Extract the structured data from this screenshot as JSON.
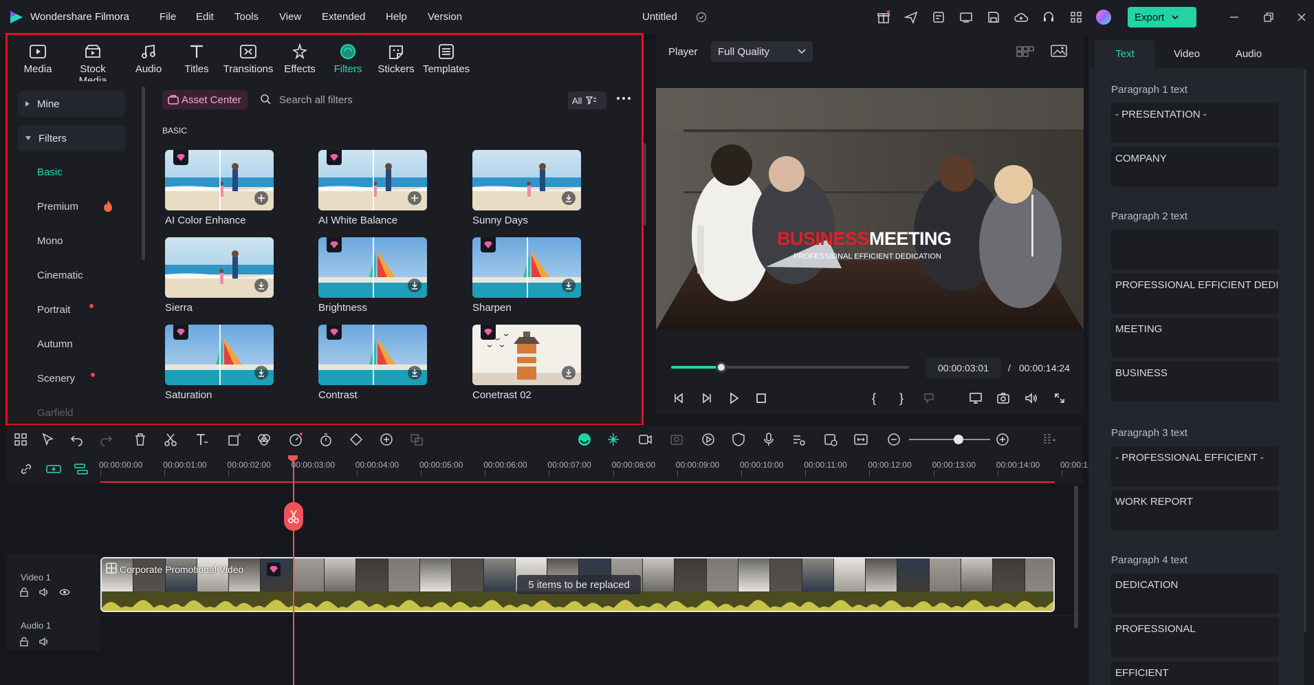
{
  "app": {
    "name": "Wondershare Filmora",
    "project_title": "Untitled",
    "menu": [
      "File",
      "Edit",
      "Tools",
      "View",
      "Extended",
      "Help",
      "Version"
    ],
    "export_label": "Export"
  },
  "media_tabs": [
    {
      "label": "Media",
      "icon": "media-icon"
    },
    {
      "label": "Stock Media",
      "icon": "stock-media-icon"
    },
    {
      "label": "Audio",
      "icon": "audio-icon"
    },
    {
      "label": "Titles",
      "icon": "titles-icon"
    },
    {
      "label": "Transitions",
      "icon": "transitions-icon"
    },
    {
      "label": "Effects",
      "icon": "effects-icon"
    },
    {
      "label": "Filters",
      "icon": "filters-icon",
      "active": true
    },
    {
      "label": "Stickers",
      "icon": "stickers-icon"
    },
    {
      "label": "Templates",
      "icon": "templates-icon"
    }
  ],
  "side_nav": {
    "mine": "Mine",
    "filters": "Filters",
    "items": [
      "Basic",
      "Premium",
      "Mono",
      "Cinematic",
      "Portrait",
      "Autumn",
      "Scenery",
      "Garfield"
    ]
  },
  "browser": {
    "asset_center": "Asset Center",
    "search_placeholder": "Search all filters",
    "all_label": "All",
    "section": "BASIC",
    "filters": [
      {
        "label": "AI Color Enhance",
        "scene": "beach",
        "premium": true,
        "action": "add"
      },
      {
        "label": "AI White Balance",
        "scene": "beach",
        "premium": true,
        "action": "add"
      },
      {
        "label": "Sunny Days",
        "scene": "beach",
        "premium": false,
        "action": "download"
      },
      {
        "label": "Sierra",
        "scene": "beach",
        "premium": false,
        "action": "download"
      },
      {
        "label": "Brightness",
        "scene": "sail",
        "premium": true,
        "action": "download"
      },
      {
        "label": "Sharpen",
        "scene": "sail",
        "premium": true,
        "action": "download"
      },
      {
        "label": "Saturation",
        "scene": "sail",
        "premium": true,
        "action": "download"
      },
      {
        "label": "Contrast",
        "scene": "sail",
        "premium": true,
        "action": "download"
      },
      {
        "label": "Conetrast 02",
        "scene": "tower",
        "premium": true,
        "action": "download"
      }
    ]
  },
  "player": {
    "label": "Player",
    "quality": "Full Quality",
    "overlay_title_red": "BUSINESS",
    "overlay_title_white": "MEETING",
    "overlay_subtitle": "PROFESSIONAL EFFICIENT DEDICATION",
    "current_time": "00:00:03:01",
    "separator": "/",
    "total_time": "00:00:14:24",
    "progress": 0.21
  },
  "text_panel": {
    "tabs": [
      "Text",
      "Video",
      "Audio"
    ],
    "paragraphs": [
      {
        "title": "Paragraph 1 text",
        "fields": [
          "- PRESENTATION -",
          "COMPANY"
        ]
      },
      {
        "title": "Paragraph 2 text",
        "fields": [
          "",
          "PROFESSIONAL EFFICIENT DEDICATI",
          "MEETING",
          "BUSINESS"
        ]
      },
      {
        "title": "Paragraph 3 text",
        "fields": [
          "- PROFESSIONAL EFFICIENT  -",
          "WORK REPORT"
        ]
      },
      {
        "title": "Paragraph 4 text",
        "fields": [
          "DEDICATION",
          "PROFESSIONAL",
          "EFFICIENT"
        ]
      }
    ]
  },
  "timeline": {
    "ticks": [
      "00:00:00:00",
      "00:00:01:00",
      "00:00:02:00",
      "00:00:03:00",
      "00:00:04:00",
      "00:00:05:00",
      "00:00:06:00",
      "00:00:07:00",
      "00:00:08:00",
      "00:00:09:00",
      "00:00:10:00",
      "00:00:11:00",
      "00:00:12:00",
      "00:00:13:00",
      "00:00:14:00",
      "00:00:1"
    ],
    "video_track": "Video 1",
    "audio_track": "Audio 1",
    "clip_name": "Corporate Promotional Video",
    "replace_badge": "5 items to be replaced"
  },
  "colors": {
    "accent": "#27d8b2",
    "export": "#22d3a5",
    "highlight_frame": "#e1131f",
    "playhead": "#f15257"
  }
}
